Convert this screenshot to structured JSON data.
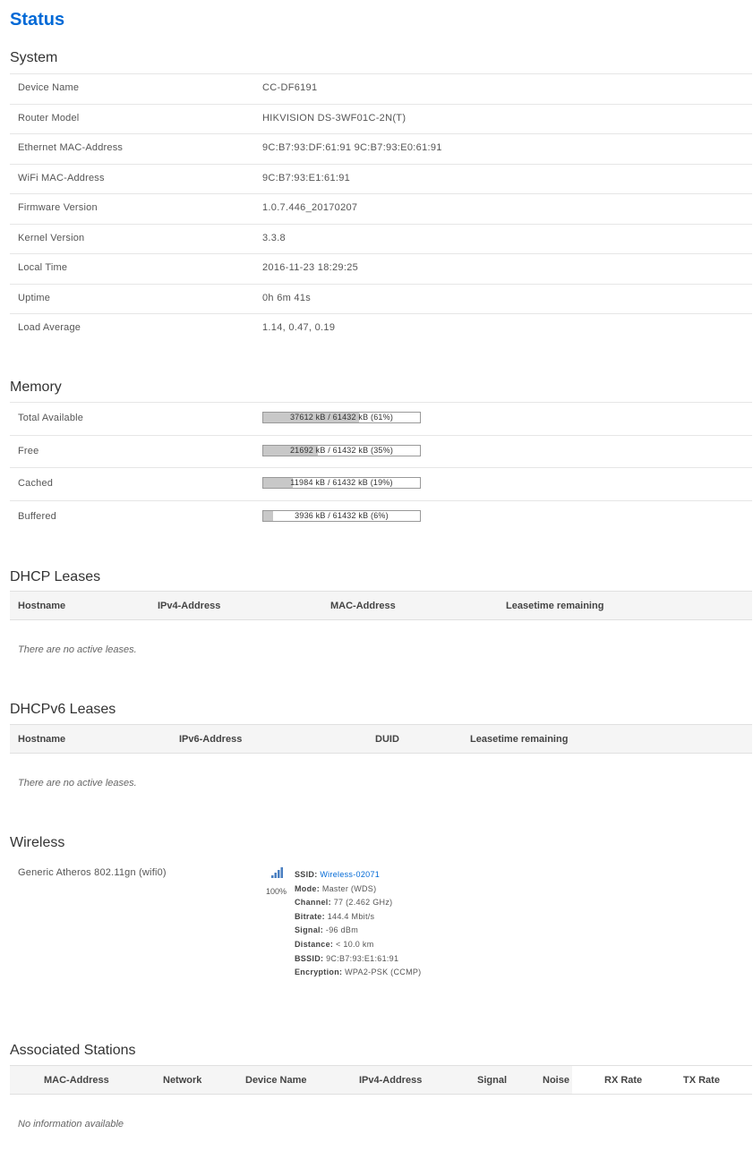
{
  "page_title": "Status",
  "system": {
    "title": "System",
    "rows": [
      {
        "key": "Device Name",
        "value": "CC-DF6191"
      },
      {
        "key": "Router Model",
        "value": "HIKVISION DS-3WF01C-2N(T)"
      },
      {
        "key": "Ethernet MAC-Address",
        "value": "9C:B7:93:DF:61:91 9C:B7:93:E0:61:91"
      },
      {
        "key": "WiFi MAC-Address",
        "value": "9C:B7:93:E1:61:91"
      },
      {
        "key": "Firmware Version",
        "value": "1.0.7.446_20170207"
      },
      {
        "key": "Kernel Version",
        "value": "3.3.8"
      },
      {
        "key": "Local Time",
        "value": "2016-11-23 18:29:25"
      },
      {
        "key": "Uptime",
        "value": "0h 6m 41s"
      },
      {
        "key": "Load Average",
        "value": "1.14, 0.47, 0.19"
      }
    ]
  },
  "memory": {
    "title": "Memory",
    "rows": [
      {
        "key": "Total Available",
        "text": "37612 kB / 61432 kB (61%)",
        "fraction": 0.61
      },
      {
        "key": "Free",
        "text": "21692 kB / 61432 kB (35%)",
        "fraction": 0.35
      },
      {
        "key": "Cached",
        "text": "11984 kB / 61432 kB (19%)",
        "fraction": 0.19
      },
      {
        "key": "Buffered",
        "text": "3936 kB / 61432 kB (6%)",
        "fraction": 0.06
      }
    ]
  },
  "dhcp": {
    "title": "DHCP Leases",
    "columns": [
      "Hostname",
      "IPv4-Address",
      "MAC-Address",
      "Leasetime remaining"
    ],
    "empty": "There are no active leases."
  },
  "dhcpv6": {
    "title": "DHCPv6 Leases",
    "columns": [
      "Hostname",
      "IPv6-Address",
      "DUID",
      "Leasetime remaining"
    ],
    "empty": "There are no active leases."
  },
  "wireless": {
    "title": "Wireless",
    "device": "Generic Atheros 802.11gn (wifi0)",
    "signal_percent": "100%",
    "details": [
      {
        "label": "SSID:",
        "value": "Wireless-02071",
        "link": true
      },
      {
        "label": "Mode:",
        "value": "Master (WDS)"
      },
      {
        "label": "Channel:",
        "value": "77 (2.462 GHz)"
      },
      {
        "label": "Bitrate:",
        "value": "144.4 Mbit/s"
      },
      {
        "label": "Signal:",
        "value": "-96 dBm"
      },
      {
        "label": "Distance:",
        "value": "< 10.0 km"
      },
      {
        "label": "BSSID:",
        "value": "9C:B7:93:E1:61:91"
      },
      {
        "label": "Encryption:",
        "value": "WPA2-PSK (CCMP)"
      }
    ]
  },
  "stations": {
    "title": "Associated Stations",
    "columns": [
      "MAC-Address",
      "Network",
      "Device Name",
      "IPv4-Address",
      "Signal",
      "Noise",
      "RX Rate",
      "TX Rate"
    ],
    "empty": "No information available"
  }
}
